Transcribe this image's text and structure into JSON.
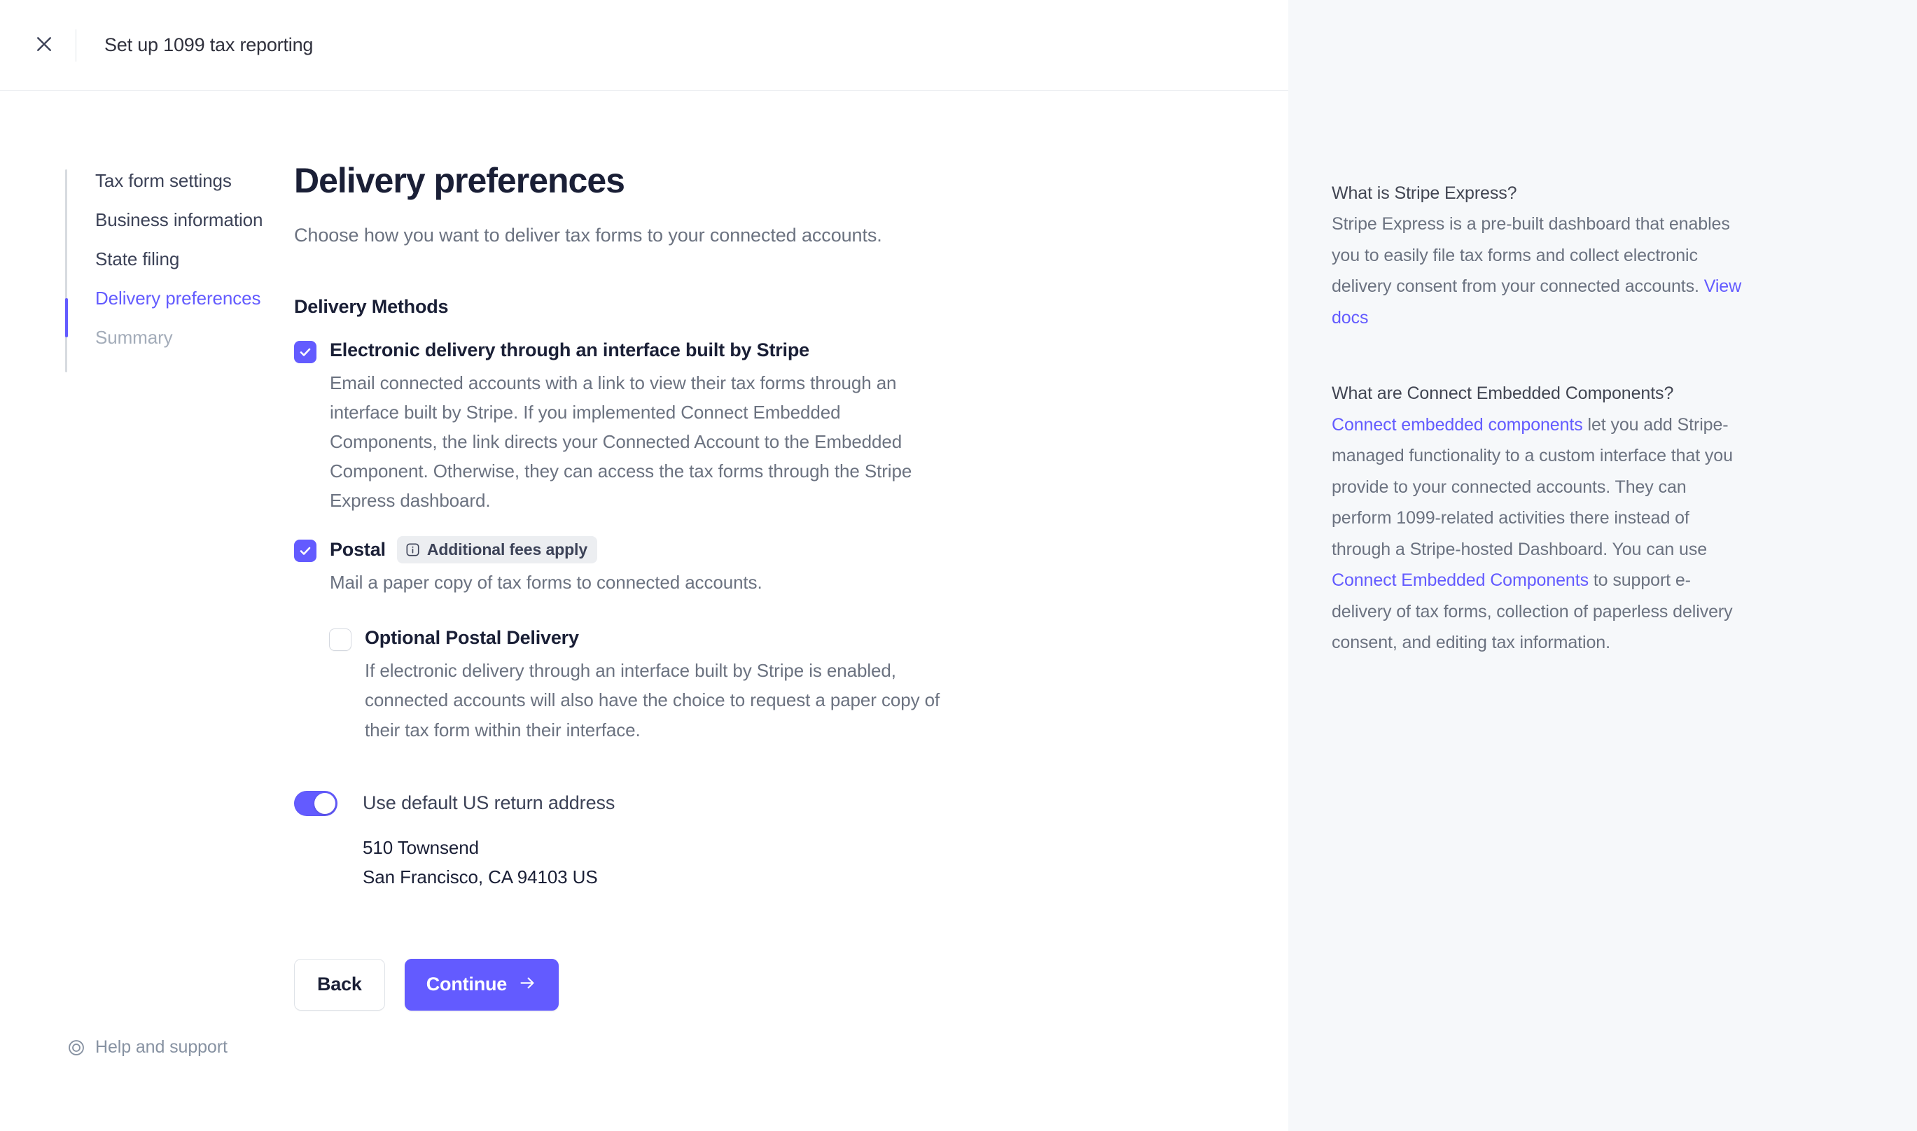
{
  "header": {
    "close_icon": "close-icon",
    "title": "Set up 1099 tax reporting"
  },
  "stepper": {
    "items": [
      {
        "label": "Tax form settings",
        "state": "done"
      },
      {
        "label": "Business information",
        "state": "done"
      },
      {
        "label": "State filing",
        "state": "done"
      },
      {
        "label": "Delivery preferences",
        "state": "active"
      },
      {
        "label": "Summary",
        "state": "disabled"
      }
    ]
  },
  "page": {
    "title": "Delivery preferences",
    "subtitle": "Choose how you want to deliver tax forms to your connected accounts.",
    "section_title": "Delivery Methods"
  },
  "options": {
    "electronic": {
      "checked": true,
      "label": "Electronic delivery through an interface built by Stripe",
      "description": "Email connected accounts with a link to view their tax forms through an interface built by Stripe. If you implemented Connect Embedded Components, the link directs your Connected Account to the Embedded Component. Otherwise, they can access the tax forms through the Stripe Express dashboard."
    },
    "postal": {
      "checked": true,
      "label": "Postal",
      "badge_label": "Additional fees apply",
      "badge_icon": "info-icon",
      "description": "Mail a paper copy of tax forms to connected accounts."
    },
    "optional_postal": {
      "checked": false,
      "label": "Optional Postal Delivery",
      "description": "If electronic delivery through an interface built by Stripe is enabled, connected accounts will also have the choice to request a paper copy of their tax form within their interface."
    }
  },
  "return_address": {
    "toggle_on": true,
    "toggle_label": "Use default US return address",
    "line1": "510 Townsend",
    "line2": "San Francisco, CA 94103 US"
  },
  "actions": {
    "back_label": "Back",
    "continue_label": "Continue",
    "continue_icon": "arrow-right-icon"
  },
  "footer": {
    "icon": "lifebuoy-icon",
    "label": "Help and support"
  },
  "info_panel": {
    "blocks": [
      {
        "title": "What is Stripe Express?",
        "body_before": "Stripe Express is a pre-built dashboard that enables you to easily file tax forms and collect electronic delivery consent from your connected accounts. ",
        "link1": "View docs",
        "body_middle": "",
        "link2": "",
        "body_after": ""
      },
      {
        "title": "What are Connect Embedded Components?",
        "link1": "Connect embedded components",
        "body_middle": " let you add Stripe-managed functionality to a custom interface that you provide to your connected accounts. They can perform 1099-related activities there instead of through a Stripe-hosted Dashboard. You can use ",
        "link2": "Connect Embedded Components",
        "body_after": " to support e-delivery of tax forms, collection of paperless delivery consent, and editing tax information."
      }
    ]
  },
  "colors": {
    "accent": "#635BFF",
    "text_primary": "#1A1F36",
    "text_secondary": "#6B7280",
    "panel_bg": "#F6F8FA",
    "deco_blue": "#4F7FE0",
    "deco_cyan": "#5FD0F3"
  }
}
